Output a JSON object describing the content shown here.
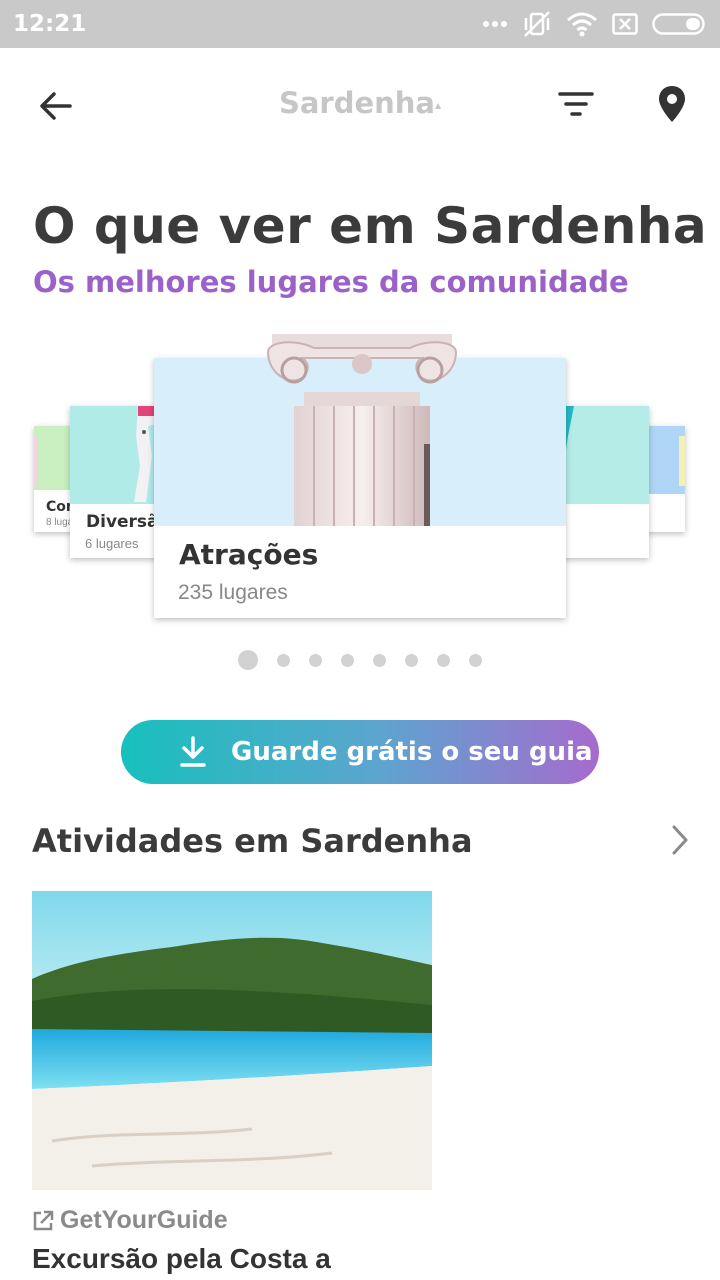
{
  "status_bar": {
    "time": "12:21",
    "icons": [
      "more-icon",
      "vibrate-off-icon",
      "wifi-icon",
      "sim-x-icon",
      "battery-icon"
    ]
  },
  "header": {
    "title": "Sardenha",
    "caret": "▴",
    "back_icon": "back-arrow-icon",
    "filter_icon": "filter-icon",
    "map_icon": "map-pin-icon"
  },
  "page": {
    "heading": "O que ver em Sardenha",
    "subheading": "Os melhores lugares da comunidade"
  },
  "carousel": {
    "cards": [
      {
        "title": "Com",
        "count": "8 luga"
      },
      {
        "title": "Diversã",
        "count": "6 lugares"
      },
      {
        "title": "Atrações",
        "count": "235 lugares"
      }
    ],
    "page_count": 8,
    "active_index": 0
  },
  "cta": {
    "label": "Guarde grátis o seu guia",
    "icon": "download-icon"
  },
  "activities": {
    "title": "Atividades em Sardenha",
    "items": [
      {
        "provider": "GetYourGuide",
        "title": "Excursão pela Costa a"
      }
    ]
  },
  "colors": {
    "accent_purple": "#9b61c9",
    "cta_start": "#17c0bd",
    "cta_end": "#a56bce",
    "status_bar": "#c9c9c9"
  }
}
